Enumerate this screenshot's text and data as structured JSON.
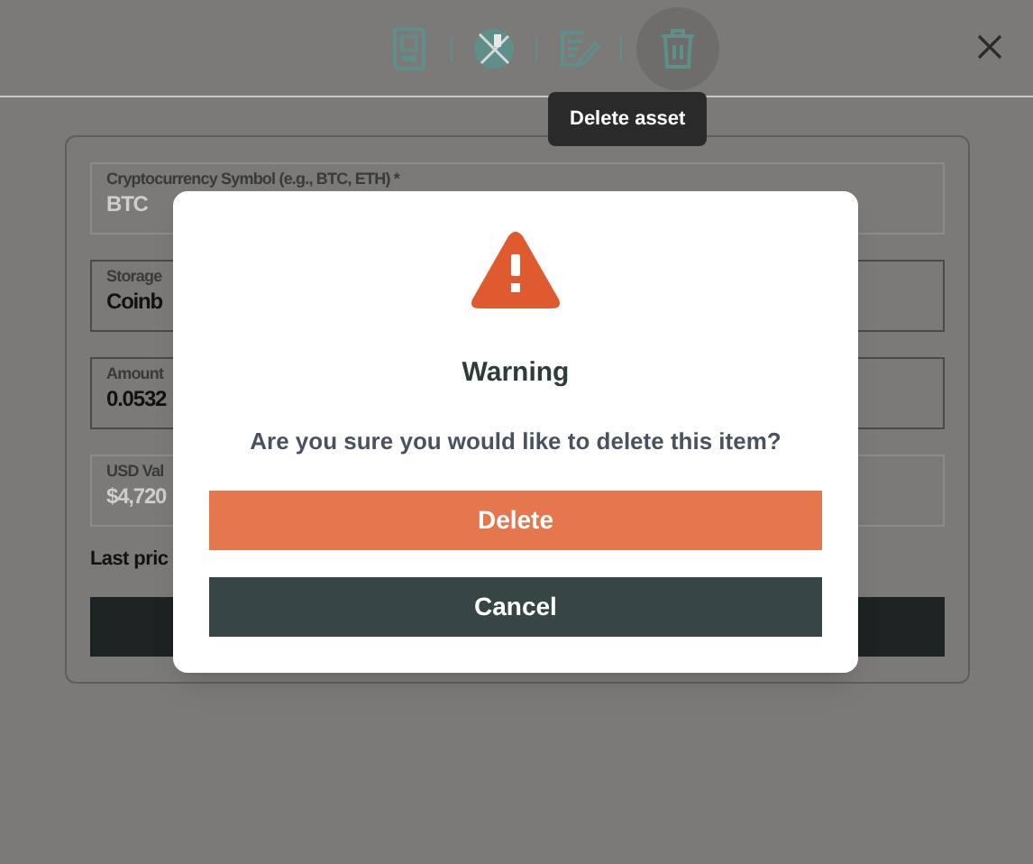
{
  "toolbar": {
    "items": [
      {
        "kind": "device",
        "hovered": false
      },
      {
        "kind": "crossed",
        "hovered": false
      },
      {
        "kind": "edit",
        "hovered": false
      },
      {
        "kind": "trash",
        "hovered": true
      }
    ],
    "tooltip": "Delete asset"
  },
  "form": {
    "fields": [
      {
        "label": "Cryptocurrency Symbol (e.g., BTC, ETH) *",
        "value": "BTC",
        "disabled": true
      },
      {
        "label": "Storage",
        "value": "Coinb",
        "disabled": false
      },
      {
        "label": "Amount",
        "value": "0.0532",
        "disabled": false
      },
      {
        "label": "USD Val",
        "value": "$4,720",
        "disabled": true
      }
    ],
    "note": "Last pric"
  },
  "dialog": {
    "title": "Warning",
    "message": "Are you sure you would like to delete this item?",
    "buttons": [
      {
        "kind": "danger",
        "label": "Delete"
      },
      {
        "kind": "secondary",
        "label": "Cancel"
      }
    ]
  }
}
